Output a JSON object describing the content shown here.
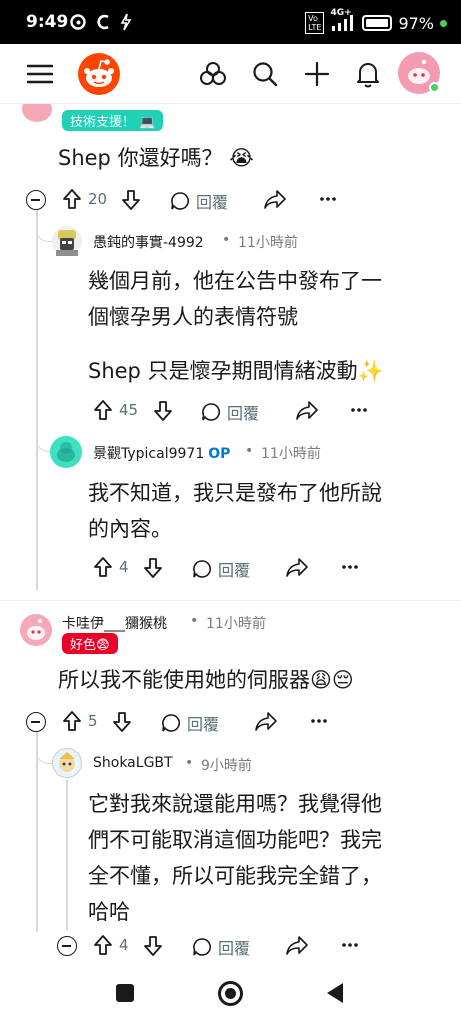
{
  "status_bar": {
    "time": "9:49",
    "icons": [
      "threads-icon",
      "c-app-icon",
      "charging-icon"
    ],
    "network": "4G+",
    "battery": "97%"
  },
  "app_header": {
    "icons": [
      "menu-icon",
      "reddit-logo",
      "popular-icon",
      "search-icon",
      "create-icon",
      "notification-icon",
      "user-avatar"
    ]
  },
  "comments": [
    {
      "flair": "技術支援！ 💻",
      "body": "Shep 你還好嗎？ 😭",
      "votes": "20",
      "reply_label": "回覆"
    },
    {
      "username": "愚鈍的事實-4992",
      "time": "11小時前",
      "body_lines": [
        "幾個月前，他在公告中發布了一",
        "個懷孕男人的表情符號",
        "",
        "Shep 只是懷孕期間情緒波動✨"
      ],
      "votes": "45",
      "reply_label": "回覆"
    },
    {
      "username": "景觀Typical9971",
      "op": "OP",
      "time": "11小時前",
      "body_lines": [
        "我不知道，我只是發布了他所說",
        "的內容。"
      ],
      "votes": "4",
      "reply_label": "回覆"
    },
    {
      "username": "卡哇伊___獼猴桃",
      "time": "11小時前",
      "flair": "好色😨",
      "body": "所以我不能使用她的伺服器😩😔",
      "votes": "5",
      "reply_label": "回覆"
    },
    {
      "username": "ShokaLGBT",
      "time": "9小時前",
      "body_lines": [
        "它對我來說還能用嗎？我覺得他",
        "們不可能取消這個功能吧？我完",
        "全不懂，所以可能我完全錯了，",
        "哈哈"
      ],
      "votes": "4",
      "reply_label": "回覆"
    }
  ],
  "separator": "•",
  "colors": {
    "reddit_orange": "#ff4500",
    "online_green": "#46d160",
    "op_blue": "#0079d3",
    "flair_teal": "#1fd1b6",
    "flair_red": "#ea0027"
  }
}
